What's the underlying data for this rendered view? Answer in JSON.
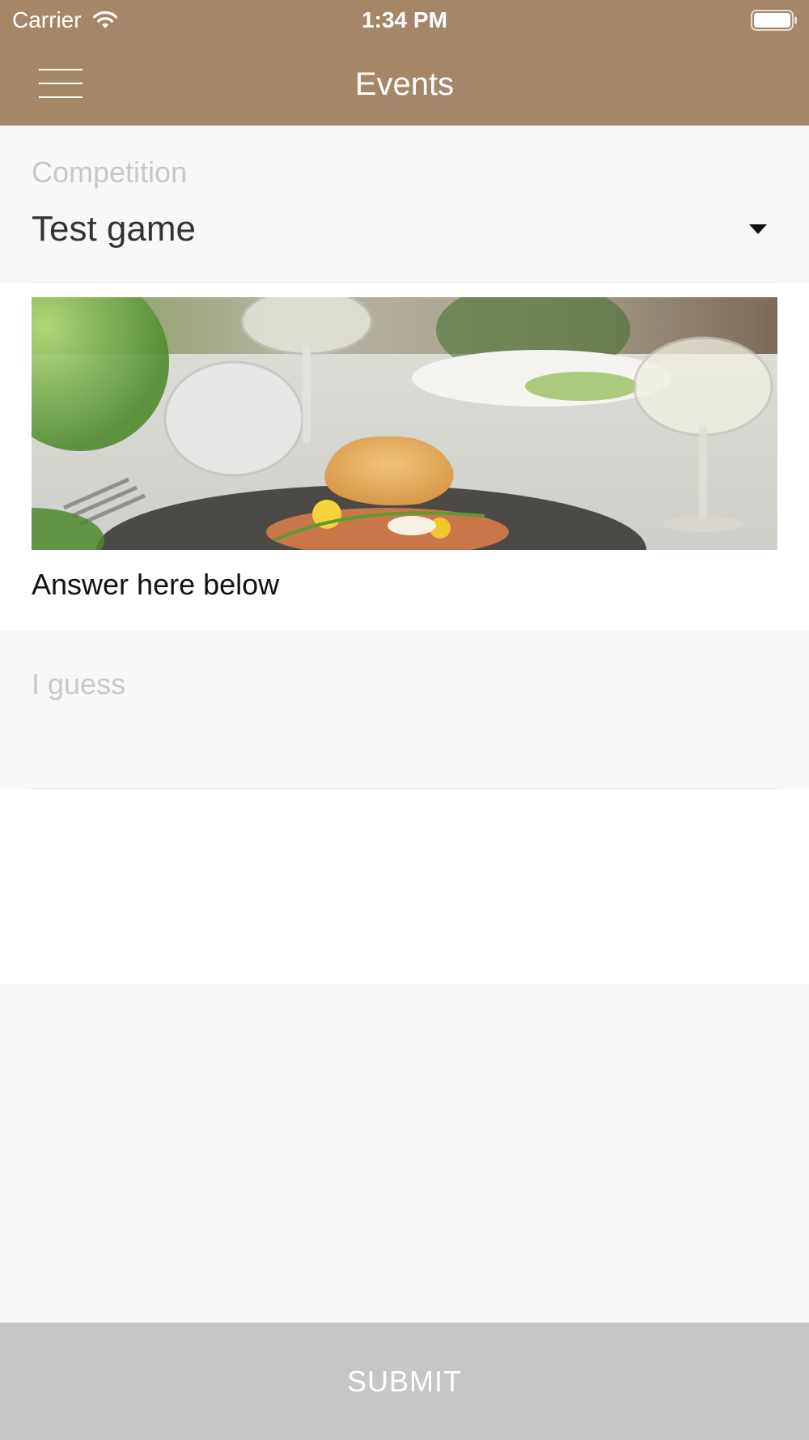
{
  "status_bar": {
    "carrier": "Carrier",
    "time": "1:34 PM",
    "icons": [
      "wifi-icon",
      "battery-icon"
    ]
  },
  "nav": {
    "title": "Events",
    "menu_icon": "hamburger-menu-icon"
  },
  "competition": {
    "label": "Competition",
    "selected_value": "Test game",
    "dropdown_icon": "caret-down-icon"
  },
  "event_image": {
    "subject": "plated dish with crispy wafer and wine glasses on restaurant table"
  },
  "answer_section": {
    "heading": "Answer here below"
  },
  "guess_field": {
    "value": "",
    "placeholder": "I guess"
  },
  "submit": {
    "label": "SUBMIT"
  },
  "colors": {
    "brand": "#a48769",
    "field_background": "#f7f9f9",
    "button_disabled": "#c6c6c6"
  }
}
